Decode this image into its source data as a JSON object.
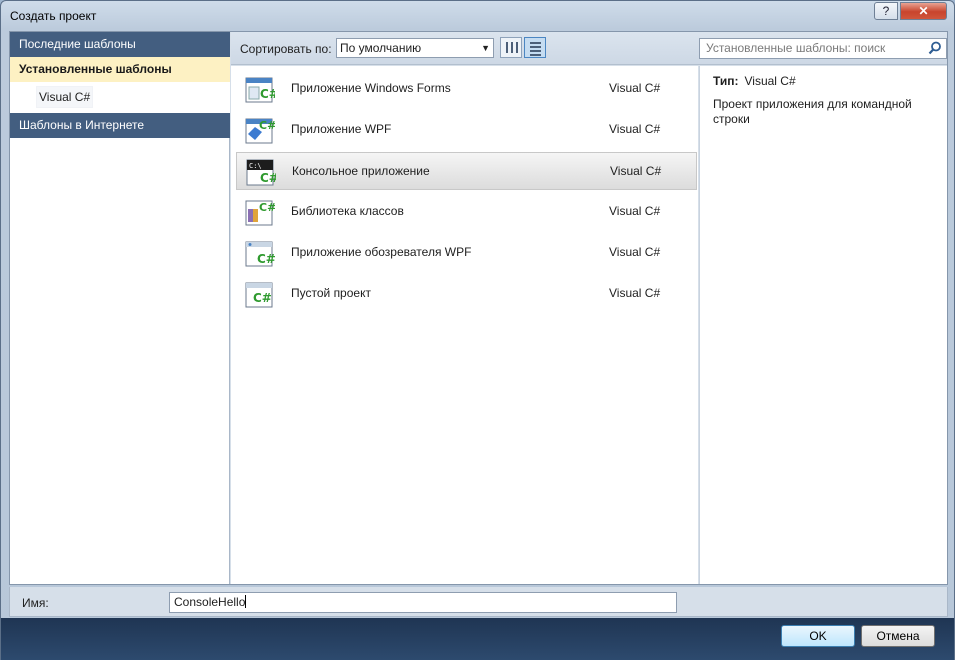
{
  "window": {
    "title": "Создать проект",
    "help_label": "?",
    "close_label": "✕"
  },
  "sidebar": {
    "items": [
      {
        "label": "Последние шаблоны"
      },
      {
        "label": "Установленные шаблоны"
      },
      {
        "label": "Visual C#"
      },
      {
        "label": "Шаблоны в Интернете"
      }
    ]
  },
  "toolbar": {
    "sort_label": "Сортировать по:",
    "sort_value": "По умолчанию",
    "search_placeholder": "Установленные шаблоны: поиск"
  },
  "templates": [
    {
      "name": "Приложение Windows Forms",
      "lang": "Visual C#",
      "icon": "winforms-project-icon"
    },
    {
      "name": "Приложение WPF",
      "lang": "Visual C#",
      "icon": "wpf-project-icon"
    },
    {
      "name": "Консольное приложение",
      "lang": "Visual C#",
      "icon": "console-project-icon",
      "selected": true
    },
    {
      "name": "Библиотека классов",
      "lang": "Visual C#",
      "icon": "class-library-icon"
    },
    {
      "name": "Приложение обозревателя WPF",
      "lang": "Visual C#",
      "icon": "wpf-browser-project-icon"
    },
    {
      "name": "Пустой проект",
      "lang": "Visual C#",
      "icon": "empty-project-icon"
    }
  ],
  "info": {
    "type_label": "Тип:",
    "type_value": "Visual C#",
    "description": "Проект приложения для командной строки"
  },
  "name_field": {
    "label": "Имя:",
    "value": "ConsoleHello"
  },
  "buttons": {
    "ok": "OK",
    "cancel": "Отмена"
  },
  "colors": {
    "sidebar_header": "#435e80",
    "selected_category": "#fdf1c3",
    "csharp_green": "#2f9a2f",
    "button_bar": "#1f3553"
  }
}
